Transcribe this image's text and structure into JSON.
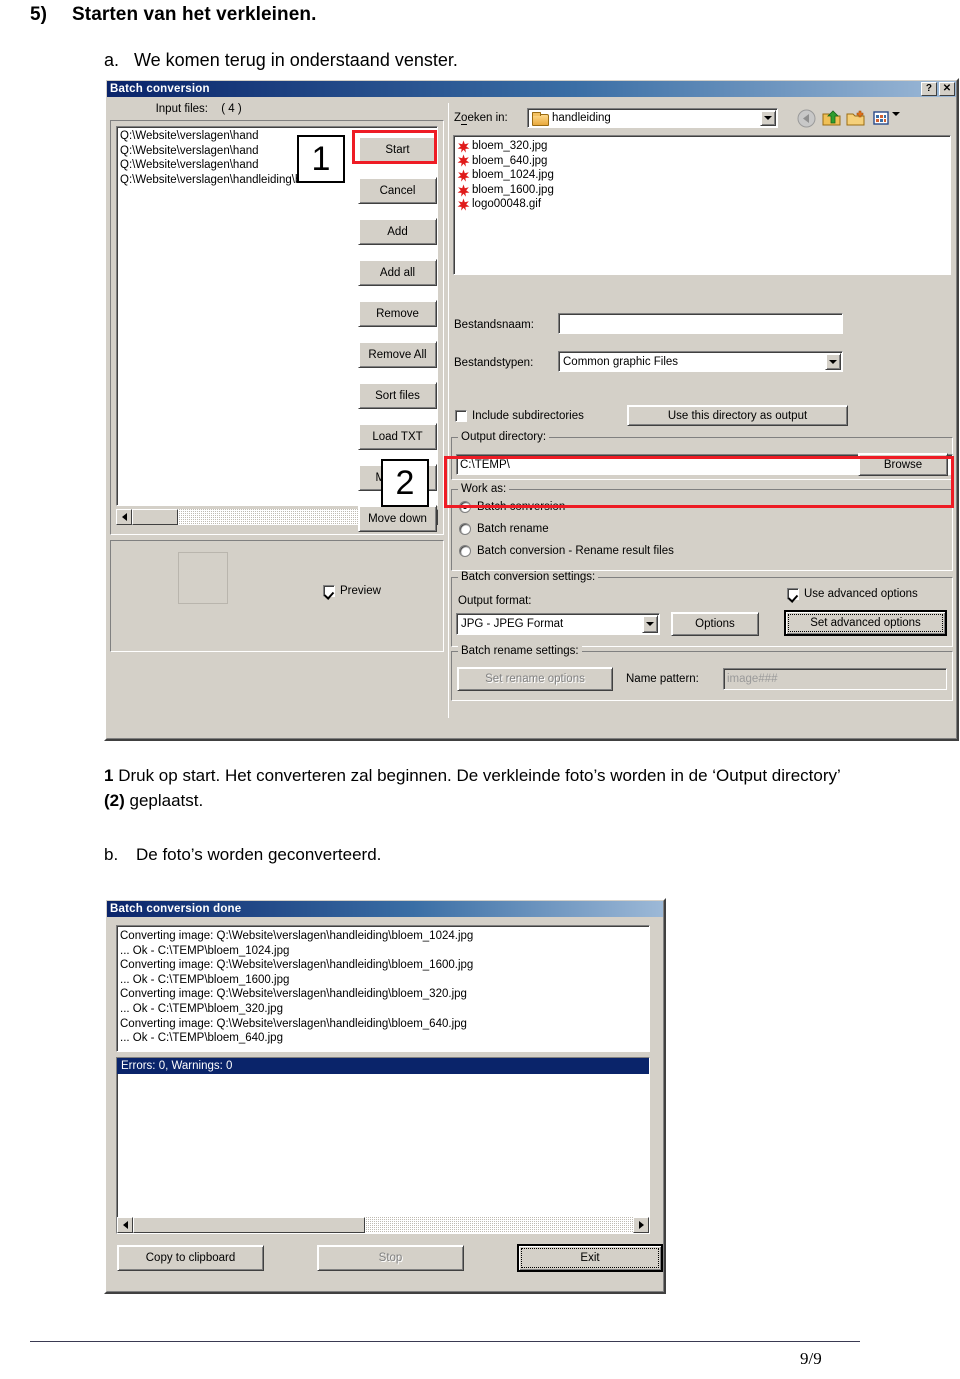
{
  "document": {
    "heading_number": "5)",
    "heading_text": "Starten van het verkleinen.",
    "sub_letter": "a.",
    "sub_text": "We komen terug in onderstaand venster.",
    "para1_marker": "1",
    "para1_text_a": " Druk op start. Het converteren zal beginnen. De verkleinde foto’s worden in de ‘Output directory’ ",
    "para1_marker2": "(2)",
    "para1_text_b": " geplaatst.",
    "para_b_letter": "b.",
    "para_b_text": "De foto’s worden geconverteerd.",
    "page_number": "9/9"
  },
  "annotations": {
    "callout_one": "1",
    "callout_two": "2",
    "highlight_color": "#ee1c25"
  },
  "batch_dialog": {
    "title": "Batch conversion",
    "help_button": "?",
    "close_button": "✕",
    "input_files_label": "Input files:",
    "input_files_count": "( 4 )",
    "input_files": [
      "Q:\\Website\\verslagen\\hand",
      "Q:\\Website\\verslagen\\hand",
      "Q:\\Website\\verslagen\\hand",
      "Q:\\Website\\verslagen\\handleiding\\blo"
    ],
    "buttons": [
      "Start",
      "Cancel",
      "Add",
      "Add all",
      "Remove",
      "Remove All",
      "Sort files",
      "Load TXT",
      "Move up",
      "Move down"
    ],
    "preview_label": "Preview",
    "preview_checked": true,
    "browser": {
      "look_in_label": "Zoeken in:",
      "look_in_value": "handleiding",
      "files": [
        "bloem_320.jpg",
        "bloem_640.jpg",
        "bloem_1024.jpg",
        "bloem_1600.jpg",
        "logo00048.gif"
      ],
      "filename_label": "Bestandsnaam:",
      "filename_value": "",
      "filetype_label": "Bestandstypen:",
      "filetype_value": "Common graphic Files",
      "include_subdirs_label": "Include subdirectories",
      "include_subdirs_checked": false,
      "use_dir_as_output_label": "Use this directory as output",
      "toolbar_icons": [
        "back-icon",
        "up-one-level-icon",
        "new-folder-icon",
        "view-menu-icon"
      ]
    },
    "output_directory": {
      "group_label": "Output directory:",
      "value": "C:\\TEMP\\",
      "browse_label": "Browse"
    },
    "work_as": {
      "group_label": "Work as:",
      "options": [
        "Batch conversion",
        "Batch rename",
        "Batch conversion - Rename result files"
      ],
      "selected_index": 0
    },
    "conversion_settings": {
      "group_label": "Batch conversion settings:",
      "output_format_label": "Output format:",
      "output_format_value": "JPG - JPEG Format",
      "options_button": "Options",
      "use_advanced_label": "Use advanced options",
      "use_advanced_checked": true,
      "set_advanced_button": "Set advanced options"
    },
    "rename_settings": {
      "group_label": "Batch rename settings:",
      "set_rename_button": "Set rename options",
      "name_pattern_label": "Name pattern:",
      "name_pattern_value": "image###"
    }
  },
  "done_dialog": {
    "title": "Batch conversion done",
    "log_lines": [
      "Converting image: Q:\\Website\\verslagen\\handleiding\\bloem_1024.jpg",
      "... Ok - C:\\TEMP\\bloem_1024.jpg",
      "Converting image: Q:\\Website\\verslagen\\handleiding\\bloem_1600.jpg",
      "... Ok - C:\\TEMP\\bloem_1600.jpg",
      "Converting image: Q:\\Website\\verslagen\\handleiding\\bloem_320.jpg",
      "... Ok - C:\\TEMP\\bloem_320.jpg",
      "Converting image: Q:\\Website\\verslagen\\handleiding\\bloem_640.jpg",
      "... Ok - C:\\TEMP\\bloem_640.jpg"
    ],
    "status_line": "Errors: 0, Warnings: 0",
    "copy_button": "Copy to clipboard",
    "stop_button": "Stop",
    "exit_button": "Exit"
  }
}
